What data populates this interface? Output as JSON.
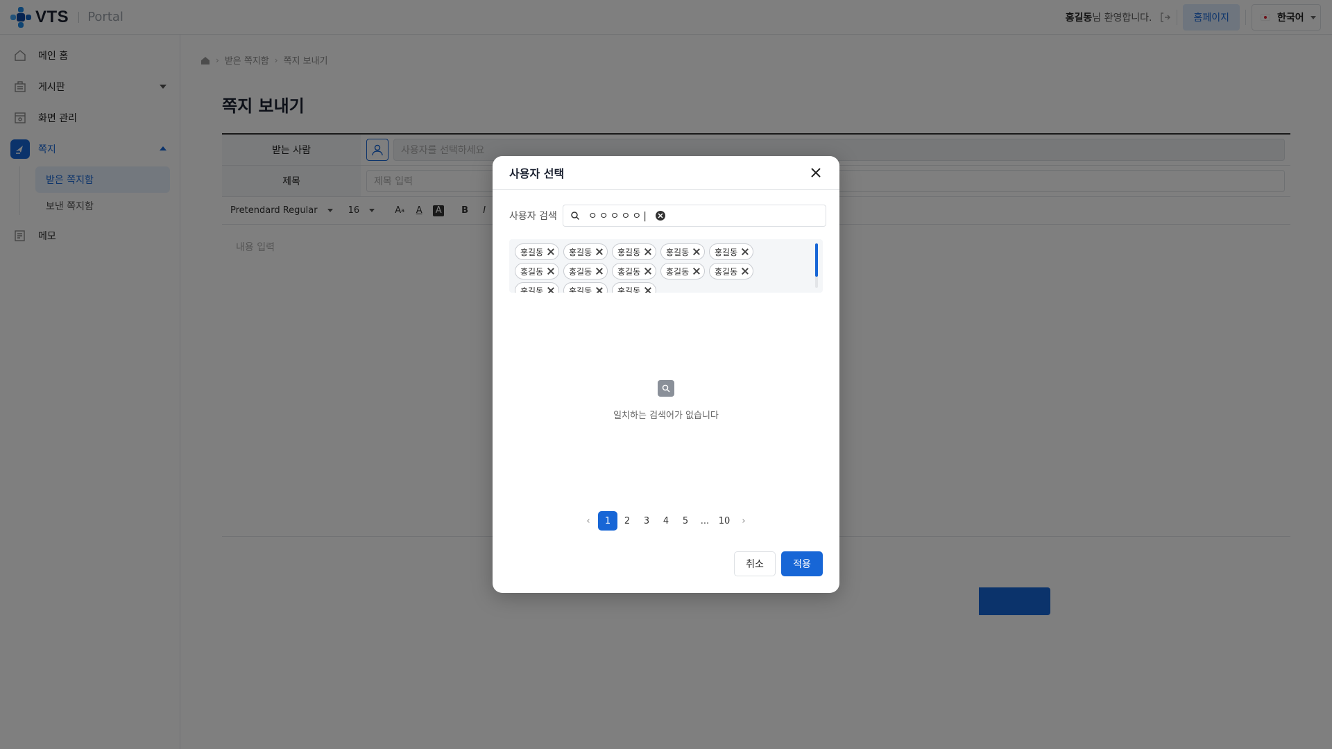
{
  "header": {
    "logo_text": "VTS",
    "logo_sub": "Portal",
    "user_name": "홍길동",
    "welcome_suffix": "님 환영합니다.",
    "home_button": "홈페이지",
    "language": "한국어"
  },
  "sidebar": {
    "items": [
      {
        "label": "메인 홈",
        "icon": "home-icon"
      },
      {
        "label": "게시판",
        "icon": "board-icon"
      },
      {
        "label": "화면 관리",
        "icon": "screen-icon"
      },
      {
        "label": "쪽지",
        "icon": "message-icon"
      },
      {
        "label": "메모",
        "icon": "memo-icon"
      }
    ],
    "sub_items": [
      {
        "label": "받은 쪽지함"
      },
      {
        "label": "보낸 쪽지함"
      }
    ]
  },
  "breadcrumb": [
    "받은 쪽지함",
    "쪽지 보내기"
  ],
  "page_title": "쪽지 보내기",
  "form": {
    "recipient_label": "받는 사람",
    "recipient_placeholder": "사용자를 선택하세요",
    "subject_label": "제목",
    "subject_placeholder": "제목 입력",
    "font_family": "Pretendard Regular",
    "font_size": "16",
    "content_placeholder": "내용 입력"
  },
  "modal": {
    "title": "사용자 선택",
    "search_label": "사용자 검색",
    "search_value": "ㅇㅇㅇㅇㅇ|",
    "tags": [
      "홍길동",
      "홍길동",
      "홍길동",
      "홍길동",
      "홍길동",
      "홍길동",
      "홍길동",
      "홍길동",
      "홍길동",
      "홍길동",
      "홍길동",
      "홍길동",
      "홍길동"
    ],
    "empty_text": "일치하는 검색어가 없습니다",
    "pages": [
      "1",
      "2",
      "3",
      "4",
      "5",
      "...",
      "10"
    ],
    "current_page": "1",
    "cancel_label": "취소",
    "apply_label": "적용"
  },
  "colors": {
    "accent": "#1766d6",
    "overlay": "rgba(0,0,0,0.5)"
  }
}
